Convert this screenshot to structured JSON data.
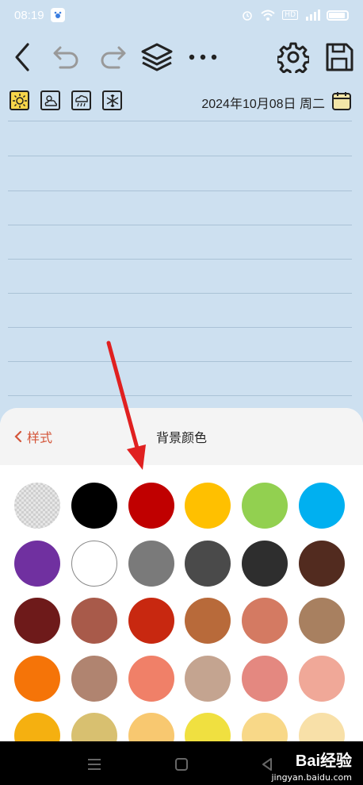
{
  "status_bar": {
    "time": "08:19",
    "hd_label": "HD"
  },
  "toolbar": {
    "icons": [
      "back-icon",
      "undo-icon",
      "redo-icon",
      "layers-icon",
      "more-icon",
      "settings-icon",
      "save-icon"
    ]
  },
  "weather": {
    "options": [
      "sunny",
      "partly-cloudy",
      "rainy",
      "snowy"
    ],
    "selected": "sunny"
  },
  "date": {
    "text": "2024年10月08日 周二"
  },
  "panel": {
    "back_label": "样式",
    "title": "背景颜色"
  },
  "colors": [
    "transparent",
    "#000000",
    "#c00000",
    "#ffc000",
    "#92d050",
    "#00b0f0",
    "#7030a0",
    "#ffffff",
    "#7a7a7a",
    "#4a4a4a",
    "#2e2e2e",
    "#522b1f",
    "#6e1a1a",
    "#a85a4a",
    "#c82810",
    "#b86a3a",
    "#d47a62",
    "#a88060",
    "#f57408",
    "#b08470",
    "#f08068",
    "#c4a490",
    "#e48880",
    "#f0a898",
    "#f5b010",
    "#d8c070",
    "#f8c870",
    "#f0e040",
    "#f8d888",
    "#f8e0a8"
  ],
  "watermark": {
    "brand": "Bai经验",
    "site": "jingyan.baidu.com"
  }
}
